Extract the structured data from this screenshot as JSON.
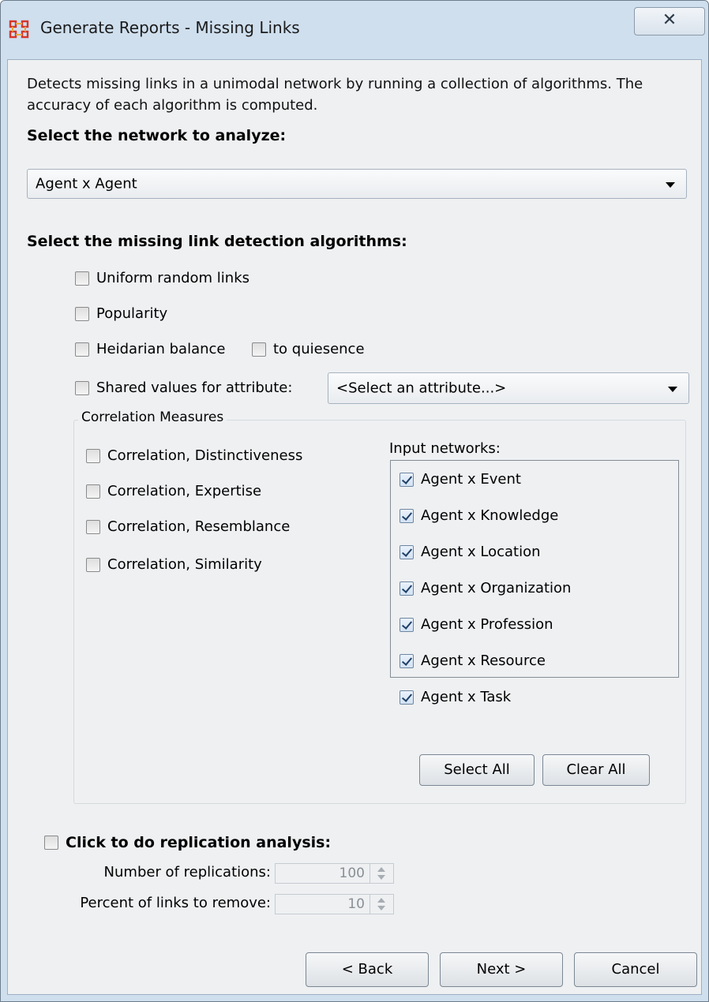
{
  "window": {
    "title": "Generate Reports - Missing Links",
    "close_glyph": "✕"
  },
  "description": "Detects missing links in a unimodal network by running a collection of algorithms. The accuracy of each algorithm is computed.",
  "network_section": {
    "label": "Select the network to analyze:",
    "selected": "Agent x Agent"
  },
  "algorithms_section": {
    "label": "Select the missing link detection algorithms:",
    "uniform_random": "Uniform random links",
    "popularity": "Popularity",
    "heidarian_balance": "Heidarian balance",
    "to_quiesence": "to quiesence",
    "shared_values": "Shared values for attribute:",
    "attribute_select": "<Select an attribute...>"
  },
  "correlation": {
    "legend": "Correlation Measures",
    "items": [
      "Correlation, Distinctiveness",
      "Correlation, Expertise",
      "Correlation, Resemblance",
      "Correlation, Similarity"
    ],
    "input_networks_label": "Input networks:",
    "input_networks": [
      "Agent x Event",
      "Agent x Knowledge",
      "Agent x Location",
      "Agent x Organization",
      "Agent x Profession",
      "Agent x Resource",
      "Agent x Task"
    ],
    "select_all": "Select All",
    "clear_all": "Clear All"
  },
  "replication": {
    "label": "Click to do replication analysis:",
    "num_replications_label": "Number of replications:",
    "num_replications": "100",
    "percent_links_label": "Percent of links to remove:",
    "percent_links": "10"
  },
  "footer": {
    "back": "< Back",
    "next": "Next >",
    "cancel": "Cancel"
  },
  "colors": {
    "window_frame": "#cfdfee",
    "client_bg": "#eef0f2",
    "icon_red": "#d8352a"
  }
}
